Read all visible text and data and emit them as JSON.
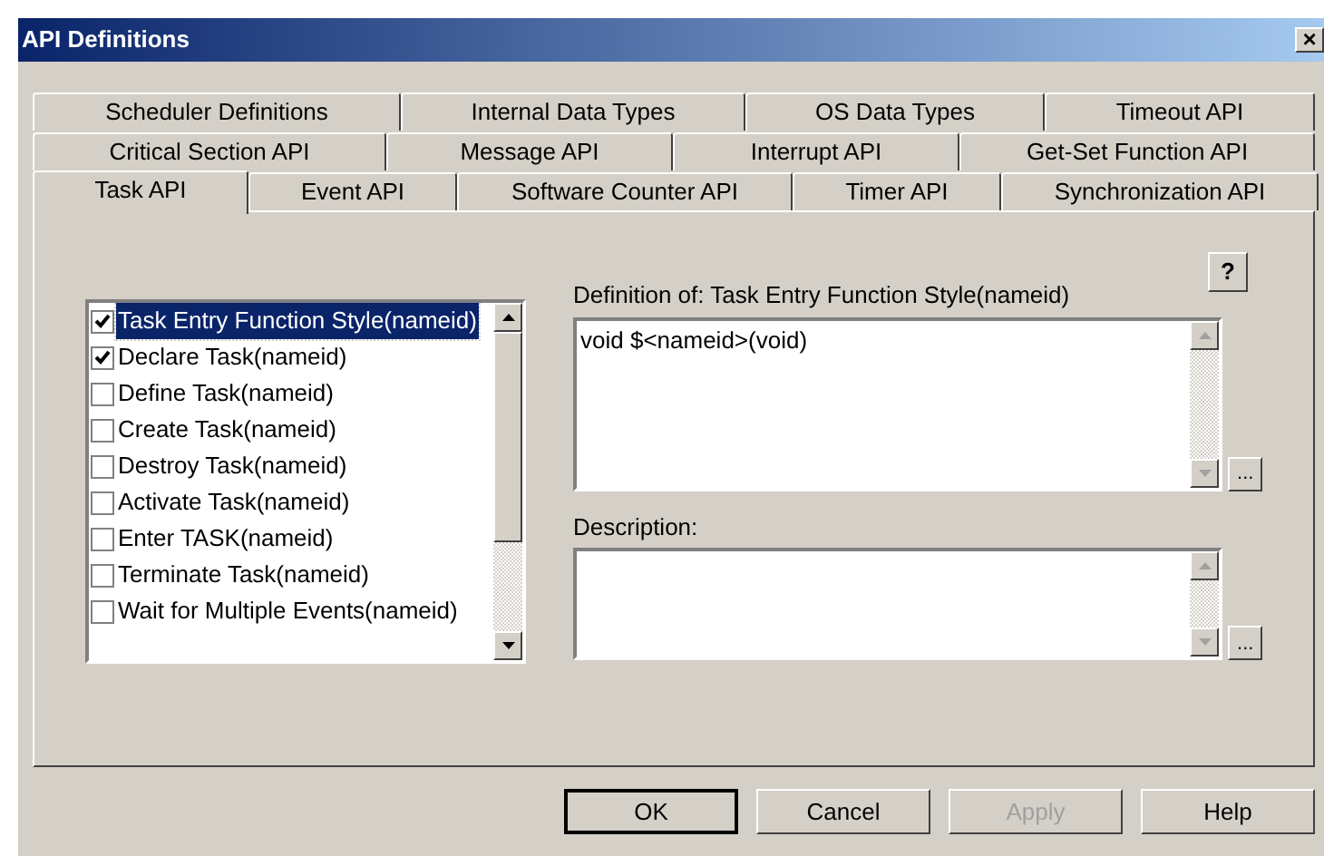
{
  "window": {
    "title": "API Definitions",
    "close": "×"
  },
  "tab_rows": [
    {
      "tabs": [
        {
          "label": "Scheduler Definitions",
          "selected": false
        },
        {
          "label": "Internal Data Types",
          "selected": false
        },
        {
          "label": "OS Data Types",
          "selected": false
        },
        {
          "label": "Timeout API",
          "selected": false
        }
      ]
    },
    {
      "tabs": [
        {
          "label": "Critical Section API",
          "selected": false
        },
        {
          "label": "Message API",
          "selected": false
        },
        {
          "label": "Interrupt API",
          "selected": false
        },
        {
          "label": "Get-Set Function API",
          "selected": false
        }
      ]
    },
    {
      "tabs": [
        {
          "label": "Task API",
          "selected": true
        },
        {
          "label": "Event API",
          "selected": false
        },
        {
          "label": "Software Counter API",
          "selected": false
        },
        {
          "label": "Timer API",
          "selected": false
        },
        {
          "label": "Synchronization API",
          "selected": false
        }
      ]
    }
  ],
  "help_button": "?",
  "api_list": [
    {
      "label": "Task Entry Function Style(nameid)",
      "checked": true,
      "selected": true
    },
    {
      "label": "Declare Task(nameid)",
      "checked": true,
      "selected": false
    },
    {
      "label": "Define Task(nameid)",
      "checked": false,
      "selected": false
    },
    {
      "label": "Create Task(nameid)",
      "checked": false,
      "selected": false
    },
    {
      "label": "Destroy Task(nameid)",
      "checked": false,
      "selected": false
    },
    {
      "label": "Activate Task(nameid)",
      "checked": false,
      "selected": false
    },
    {
      "label": "Enter TASK(nameid)",
      "checked": false,
      "selected": false
    },
    {
      "label": "Terminate Task(nameid)",
      "checked": false,
      "selected": false
    },
    {
      "label": "Wait for Multiple Events(nameid)",
      "checked": false,
      "selected": false
    }
  ],
  "definition": {
    "label": "Definition of: Task Entry Function Style(nameid)",
    "value": "void $<nameid>(void)",
    "browse": "..."
  },
  "description": {
    "label": "Description:",
    "browse": "..."
  },
  "buttons": [
    {
      "label": "OK",
      "disabled": false,
      "default": true
    },
    {
      "label": "Cancel",
      "disabled": false,
      "default": false
    },
    {
      "label": "Apply",
      "disabled": true,
      "default": false
    },
    {
      "label": "Help",
      "disabled": false,
      "default": false
    }
  ]
}
